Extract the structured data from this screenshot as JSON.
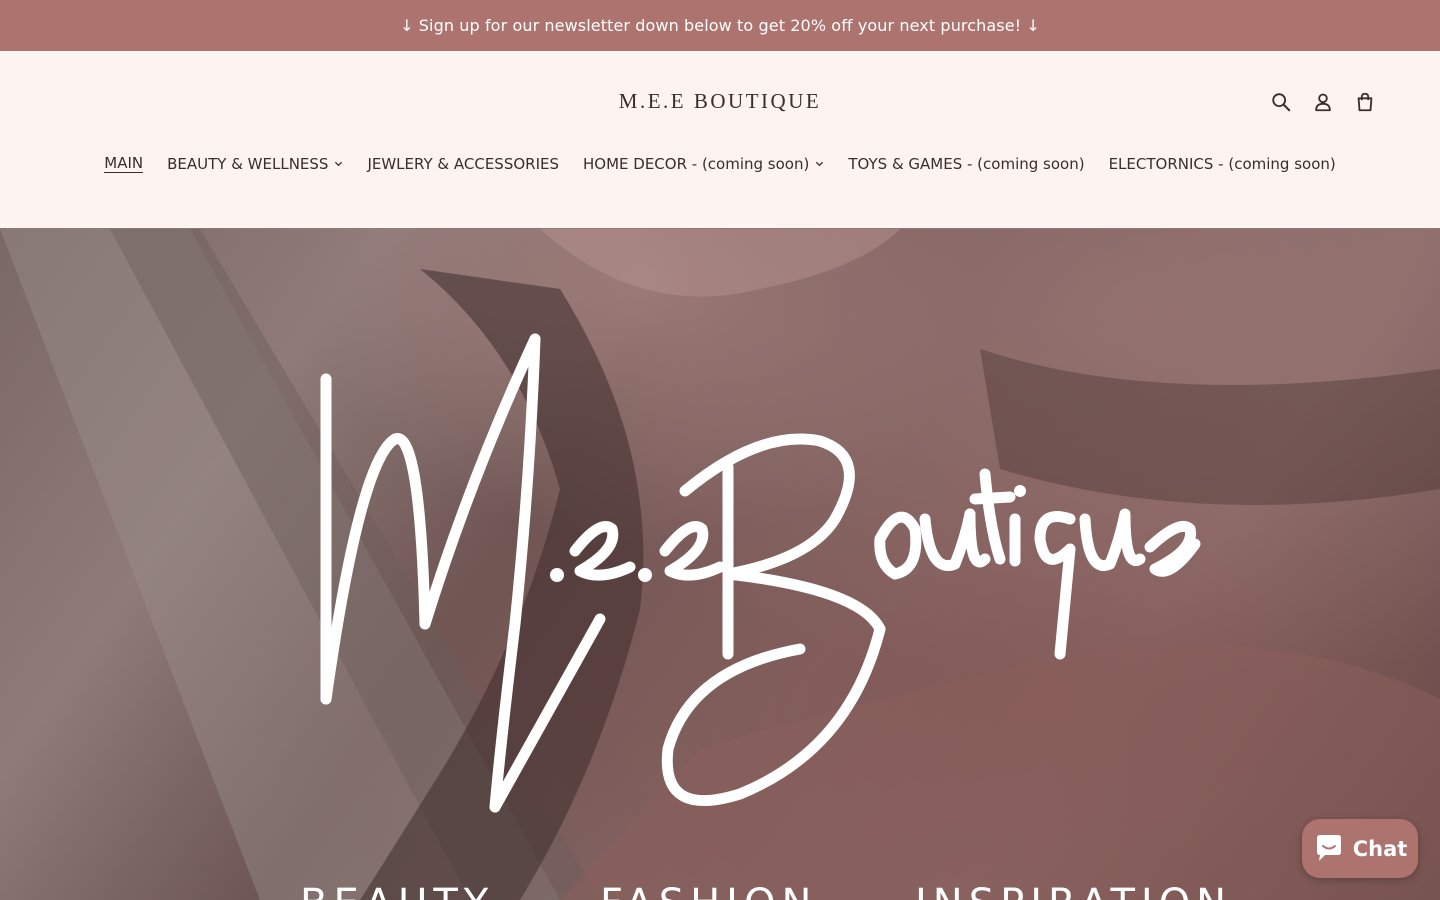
{
  "announcement": {
    "text": "↓ Sign up for our newsletter down below to get 20% off your next purchase! ↓"
  },
  "header": {
    "brand": "M.E.E BOUTIQUE",
    "icons": [
      "search-icon",
      "account-icon",
      "cart-icon"
    ]
  },
  "nav": {
    "items": [
      {
        "label": "MAIN",
        "active": true,
        "dropdown": false
      },
      {
        "label": "BEAUTY & WELLNESS",
        "active": false,
        "dropdown": true
      },
      {
        "label": "JEWLERY & ACCESSORIES",
        "active": false,
        "dropdown": false
      },
      {
        "label": "HOME DECOR - (coming soon)",
        "active": false,
        "dropdown": true
      },
      {
        "label": "TOYS & GAMES - (coming soon)",
        "active": false,
        "dropdown": false
      },
      {
        "label": "ELECTORNICS - (coming soon)",
        "active": false,
        "dropdown": false
      }
    ]
  },
  "hero": {
    "logo_text": "M.e.eBoutique",
    "taglines": [
      "BEAUTY",
      "FASHION",
      "INSPIRATION"
    ]
  },
  "chat": {
    "label": "Chat"
  },
  "colors": {
    "accent": "#ad736f",
    "header_bg": "#fdf4f1",
    "text": "#3a2d2b"
  }
}
